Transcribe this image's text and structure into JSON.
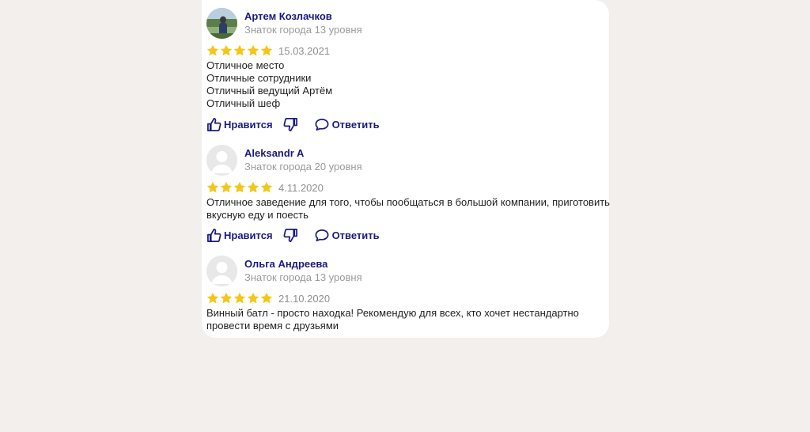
{
  "reviews": [
    {
      "author": "Артем Козлачков",
      "level": "Знаток города 13 уровня",
      "rating": 5,
      "date": "15.03.2021",
      "lines": [
        "Отличное место",
        "Отличные сотрудники",
        "Отличный ведущий Артём",
        "Отличный шеф"
      ],
      "avatar": "photo",
      "actions": {
        "like": "Нравится",
        "reply": "Ответить"
      }
    },
    {
      "author": "Aleksandr A",
      "level": "Знаток города 20 уровня",
      "rating": 5,
      "date": "4.11.2020",
      "lines": [
        "Отличное заведение для того, чтобы пообщаться в большой компании, приготовить",
        "вкусную еду и поесть"
      ],
      "avatar": "placeholder",
      "actions": {
        "like": "Нравится",
        "reply": "Ответить"
      }
    },
    {
      "author": "Ольга Андреева",
      "level": "Знаток города 13 уровня",
      "rating": 5,
      "date": "21.10.2020",
      "lines": [
        "Винный батл - просто находка! Рекомендую для всех, кто хочет нестандартно",
        "провести время с друзьями"
      ],
      "avatar": "placeholder"
    }
  ],
  "colors": {
    "accent": "#1a1a7e",
    "star": "#f5c518",
    "muted": "#9a9a9a",
    "background": "#f2efec"
  },
  "icons": {
    "like": "thumbs-up-icon",
    "dislike": "thumbs-down-icon",
    "reply": "speech-bubble-icon",
    "star": "star-icon"
  }
}
